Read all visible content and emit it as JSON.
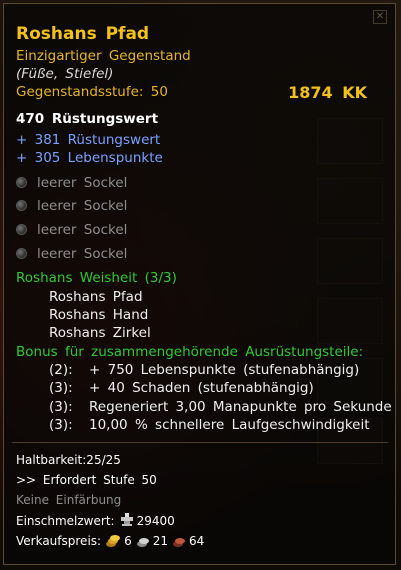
{
  "item": {
    "name": "Roshans Pfad",
    "rarity": "Einzigartiger Gegenstand",
    "slot": "(Füße, Stiefel)",
    "level_label": "Gegenstandsstufe:",
    "level_value": "50",
    "price": "1874 KK"
  },
  "armor": {
    "value": "470",
    "label": "Rüstungswert"
  },
  "bonuses": [
    "+ 381 Rüstungswert",
    "+ 305 Lebenspunkte"
  ],
  "sockets": [
    "leerer Sockel",
    "leerer Sockel",
    "leerer Sockel",
    "leerer Sockel"
  ],
  "set": {
    "title": "Roshans Weisheit (3/3)",
    "items": [
      "Roshans Pfad",
      "Roshans Hand",
      "Roshans Zirkel"
    ],
    "bonus_header": "Bonus für zusammengehörende Ausrüstungsteile:",
    "bonuses": [
      {
        "count": "(2):",
        "text": "+ 750 Lebenspunkte (stufenabhängig)"
      },
      {
        "count": "(3):",
        "text": "+ 40 Schaden (stufenabhängig)"
      },
      {
        "count": "(3):",
        "text": "Regeneriert 3,00 Manapunkte pro Sekunde"
      },
      {
        "count": "(3):",
        "text": "10,00 % schnellere Laufgeschwindigkeit"
      }
    ]
  },
  "footer": {
    "durability": "Haltbarkeit:25/25",
    "requirement": ">> Erfordert Stufe 50",
    "dye": "Keine Einfärbung",
    "melt_label": "Einschmelzwert:",
    "melt_value": "29400",
    "sell_label": "Verkaufspreis:",
    "gold": "6",
    "silver": "21",
    "copper": "64"
  },
  "colors": {
    "title": "#f2c21b",
    "blue_stat": "#7aa0ff",
    "set_green": "#2fc92f",
    "socket_grey": "#8e8e8e"
  },
  "icons": {
    "melt": "anvil-icon",
    "gold": "gold-coin-icon",
    "silver": "silver-coin-icon",
    "copper": "copper-coin-icon"
  }
}
